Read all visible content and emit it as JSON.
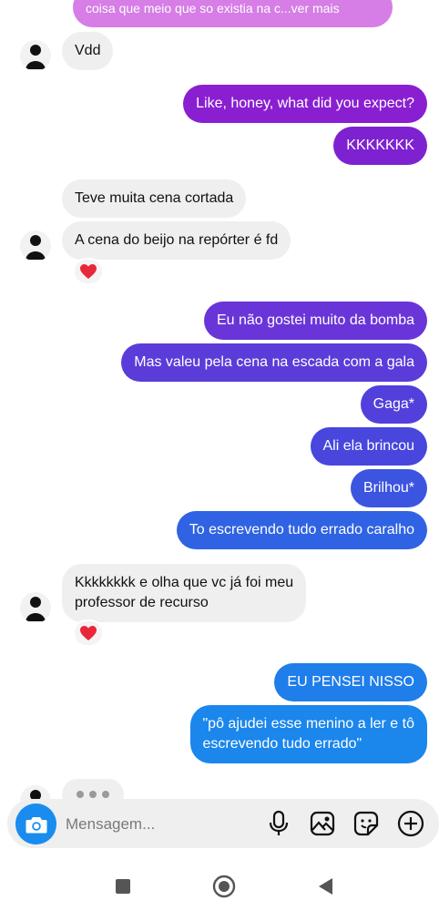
{
  "messages": {
    "top_partial": "coisa que meio que so existia na c...ver mais",
    "m1": "Vdd",
    "m2": "Like, honey, what did you expect?",
    "m3": "KKKKKKK",
    "m4": "Teve muita cena cortada",
    "m5": "A cena do beijo na repórter é fd",
    "m6": "Eu não gostei muito da bomba",
    "m7": "Mas valeu pela cena na escada com a gala",
    "m8": "Gaga*",
    "m9": "Ali ela brincou",
    "m10": "Brilhou*",
    "m11": "To escrevendo tudo errado caralho",
    "m12_line1": "Kkkkkkkk e olha que vc já foi meu",
    "m12_line2": "professor de recurso",
    "m13": "EU PENSEI NISSO",
    "m14_line1": "\"pô ajudei esse menino a ler e tô",
    "m14_line2": "escrevendo tudo errado\""
  },
  "reactions": {
    "emoji": "heart-reaction"
  },
  "composer": {
    "placeholder": "Mensagem...",
    "icons": [
      "camera-icon",
      "microphone-icon",
      "gallery-icon",
      "sticker-icon",
      "plus-icon"
    ]
  },
  "navbar": {
    "icons": [
      "recents-icon",
      "home-icon",
      "back-icon"
    ]
  },
  "colors": {
    "incoming": "#efefef",
    "outgoing_purple": "#8a1fd1",
    "outgoing_violet": "#5a3fd6",
    "outgoing_blue": "#2f63e3",
    "outgoing_lightblue": "#1b86ec",
    "camera": "#1a8cf0"
  }
}
